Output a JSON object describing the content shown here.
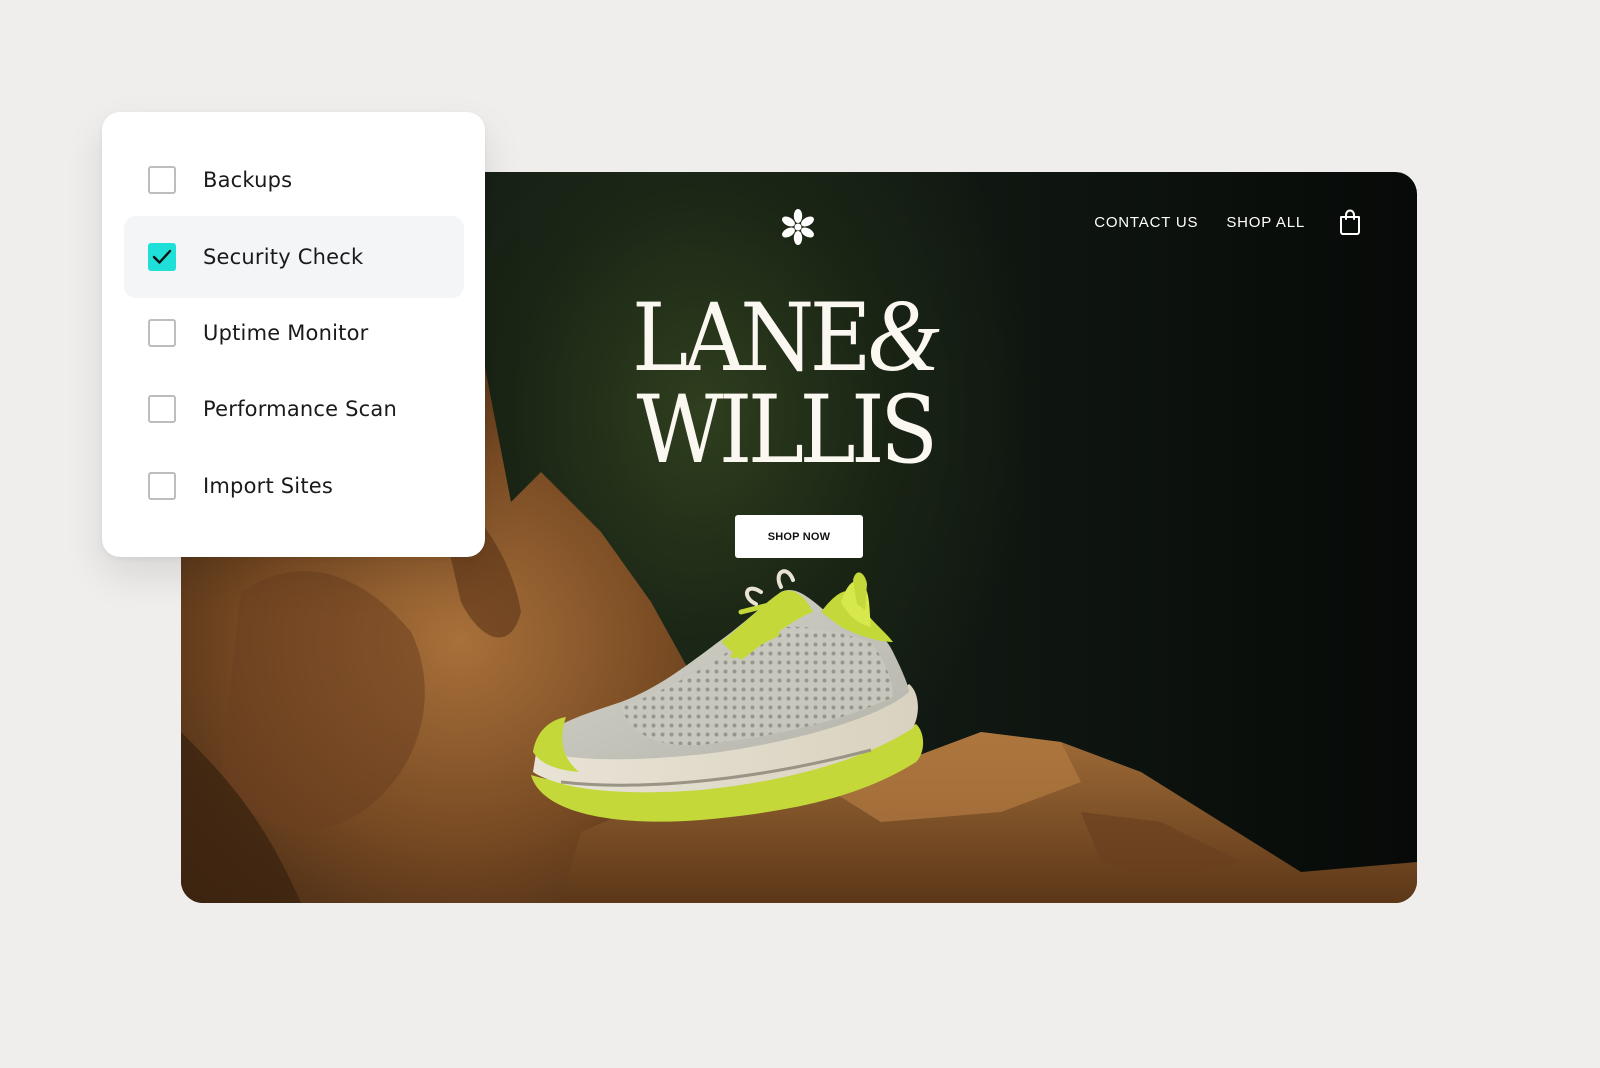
{
  "hero": {
    "nav": {
      "contact_label": "CONTACT US",
      "shop_all_label": "SHOP ALL",
      "cart_icon": "shopping-bag-icon"
    },
    "logo_icon": "asterisk-flower-icon",
    "brand": {
      "line1": "LANE",
      "amp": "&",
      "line2": "WILLIS"
    },
    "cta_label": "SHOP NOW",
    "product_image": "running-sneaker-on-rocks"
  },
  "checklist": {
    "items": [
      {
        "label": "Backups",
        "checked": false
      },
      {
        "label": "Security Check",
        "checked": true
      },
      {
        "label": "Uptime Monitor",
        "checked": false
      },
      {
        "label": "Performance Scan",
        "checked": false
      },
      {
        "label": "Import Sites",
        "checked": false
      }
    ],
    "check_icon": "checkmark-icon"
  },
  "colors": {
    "page_background": "#efeeec",
    "checkbox_checked": "#1ee0d9",
    "selected_row": "#f4f5f7",
    "hero_dark_green": "#17211a",
    "sneaker_accent": "#c4d83a",
    "rock_brown": "#8a5a2c"
  }
}
